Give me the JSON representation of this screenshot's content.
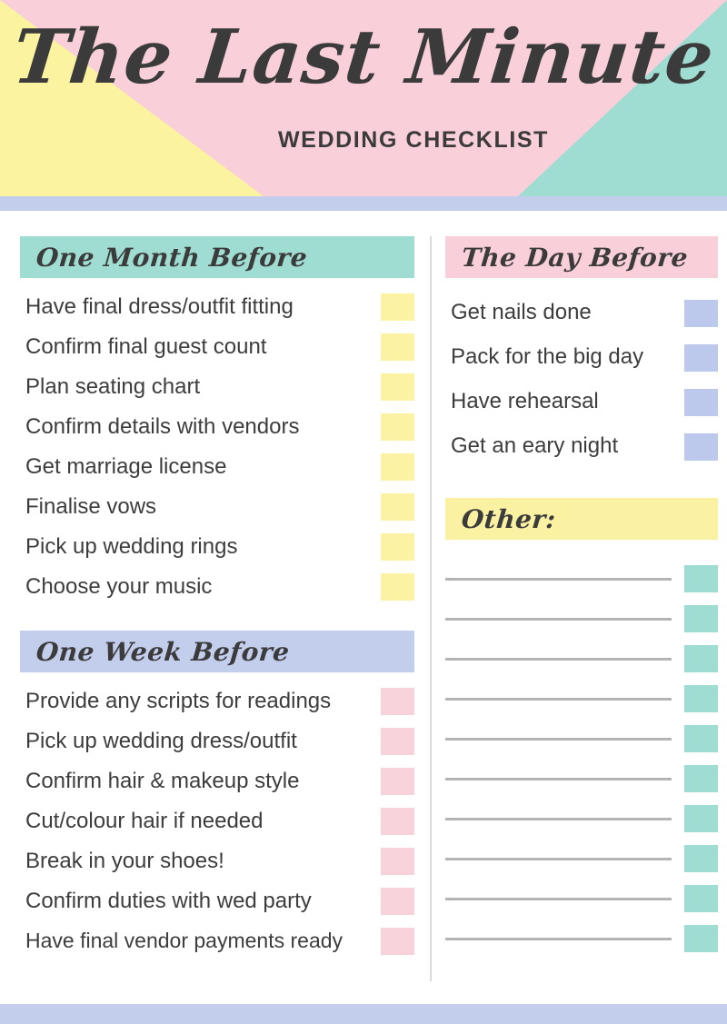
{
  "header": {
    "title": "The Last Minute",
    "subtitle": "WEDDING CHECKLIST",
    "colors": {
      "banner_pink": "#f9cfd9",
      "wedge_yellow": "#fbf3a0",
      "wedge_teal": "#9fdcd1",
      "underbar_periwinkle": "#c3cdec"
    }
  },
  "sections": {
    "one_month_before": {
      "heading": "One Month Before",
      "bar_color": "#9fdcd1",
      "box_color": "#fbf3a3",
      "items": [
        "Have final dress/outfit fitting",
        "Confirm final guest count",
        "Plan seating chart",
        "Confirm details with vendors",
        "Get marriage license",
        "Finalise vows",
        "Pick up wedding rings",
        "Choose your music"
      ]
    },
    "one_week_before": {
      "heading": "One Week Before",
      "bar_color": "#c3cdec",
      "box_color": "#f9d3dc",
      "items": [
        "Provide any scripts for readings",
        "Pick up wedding dress/outfit",
        "Confirm hair & makeup style",
        "Cut/colour hair if needed",
        "Break in your shoes!",
        "Confirm duties with wed party",
        "Have final vendor payments ready"
      ]
    },
    "the_day_before": {
      "heading": "The Day Before",
      "bar_color": "#f9cfd9",
      "box_color": "#bdc9ec",
      "items": [
        "Get nails done",
        "Pack for the big day",
        "Have rehearsal",
        "Get an eary night"
      ]
    },
    "other": {
      "heading": "Other:",
      "bar_color": "#fbf1a2",
      "box_color": "#9fdcd1",
      "blank_line_count": 10,
      "lines": [
        "",
        "",
        "",
        "",
        "",
        "",
        "",
        "",
        "",
        ""
      ]
    }
  },
  "footer": {
    "bar_color": "#c3cdec"
  }
}
